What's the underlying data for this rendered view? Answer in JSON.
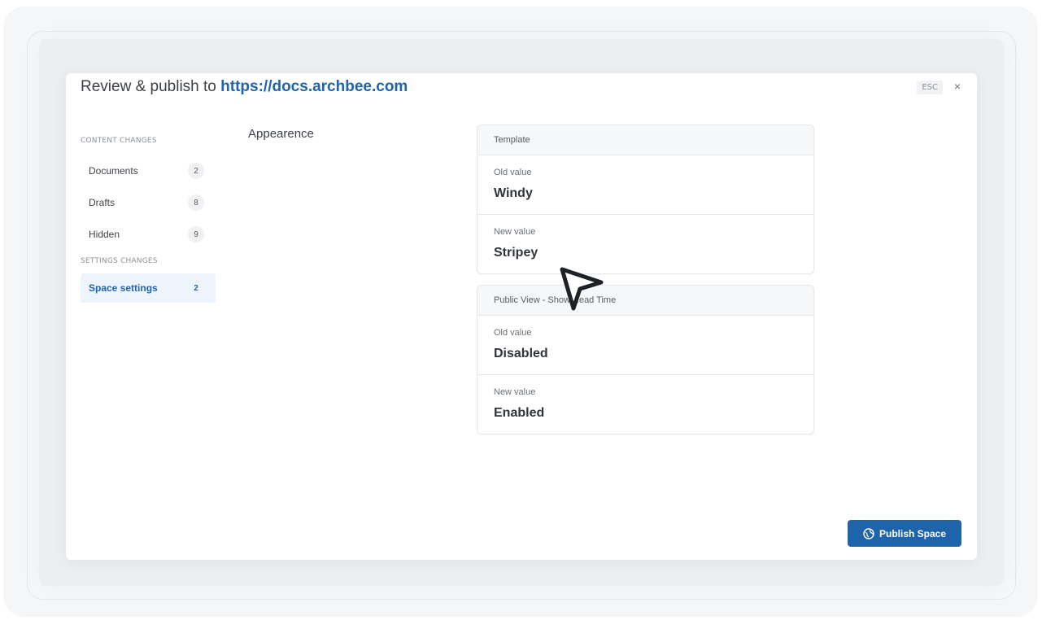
{
  "header": {
    "title_prefix": "Review & publish to",
    "title_url": "https://docs.archbee.com",
    "esc_label": "ESC",
    "close_glyph": "×"
  },
  "sidebar": {
    "content_heading": "CONTENT CHANGES",
    "content_items": [
      {
        "label": "Documents",
        "count": "2"
      },
      {
        "label": "Drafts",
        "count": "8"
      },
      {
        "label": "Hidden",
        "count": "9"
      }
    ],
    "settings_heading": "SETTINGS CHANGES",
    "settings_items": [
      {
        "label": "Space settings",
        "count": "2",
        "active": true
      }
    ]
  },
  "main": {
    "group_heading": "Appearence",
    "changes": [
      {
        "setting": "Template",
        "old_label": "Old value",
        "old_value": "Windy",
        "new_label": "New value",
        "new_value": "Stripey"
      },
      {
        "setting": "Public View - Show Read Time",
        "old_label": "Old value",
        "old_value": "Disabled",
        "new_label": "New value",
        "new_value": "Enabled"
      }
    ]
  },
  "footer": {
    "publish_label": "Publish Space",
    "publish_icon": "globe-icon"
  },
  "colors": {
    "accent": "#1f63ab",
    "link": "#1f64ad",
    "active_bg": "#eef4fb"
  },
  "cursor_icon": "mouse-pointer-icon"
}
